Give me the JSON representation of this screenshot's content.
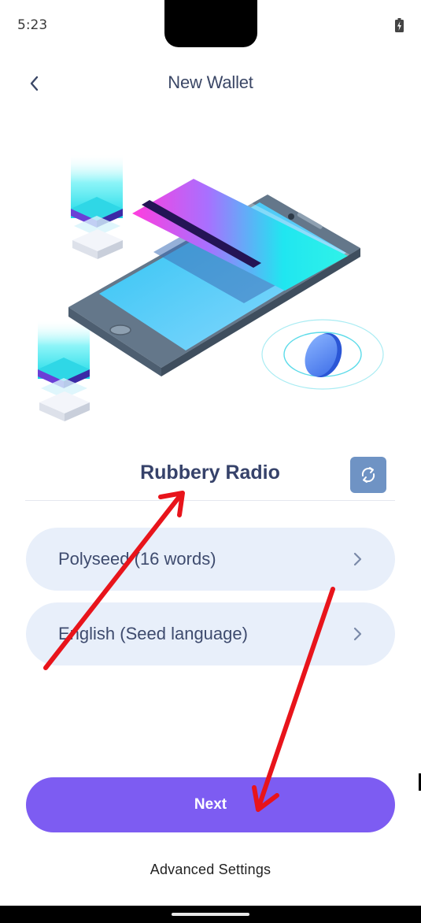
{
  "status_bar": {
    "time": "5:23",
    "battery_icon": "battery-charging-icon"
  },
  "header": {
    "title": "New Wallet",
    "back_icon": "chevron-left-icon"
  },
  "illustration": {
    "description_icon": "phone-card-coin-illustration"
  },
  "wallet": {
    "name": "Rubbery Radio",
    "refresh_icon": "refresh-icon"
  },
  "options": [
    {
      "label": "Polyseed (16 words)",
      "icon": "chevron-right-icon"
    },
    {
      "label": "English (Seed language)",
      "icon": "chevron-right-icon"
    }
  ],
  "actions": {
    "next_label": "Next",
    "advanced_label": "Advanced Settings"
  },
  "colors": {
    "accent": "#7d5cf2",
    "pill_bg": "#e8effa",
    "refresh_bg": "#6f93c4",
    "annotation": "#e8141b"
  }
}
